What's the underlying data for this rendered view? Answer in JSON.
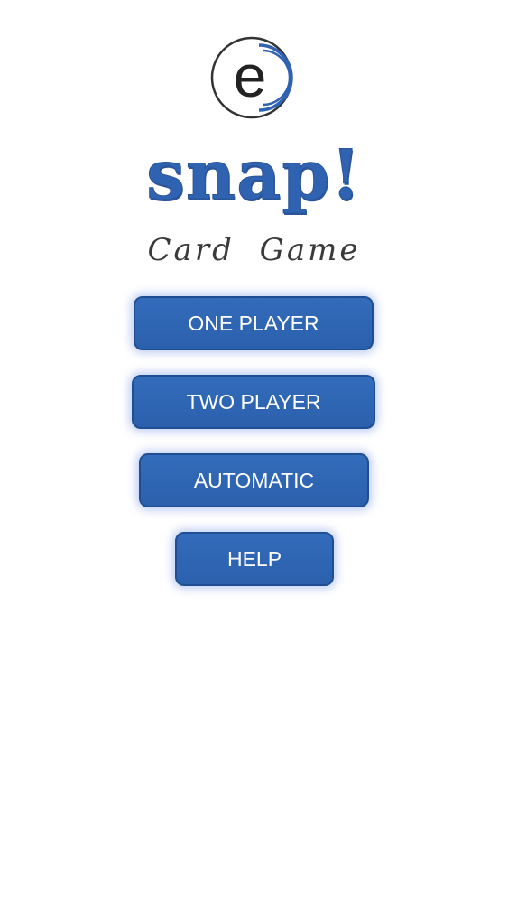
{
  "logo": {
    "icon": "e-circle-logo-icon",
    "letter": "e",
    "ring_color": "#2f62b0",
    "letter_color": "#222222"
  },
  "title": "snap!",
  "subtitle": "Card Game",
  "menu": {
    "one_player": "ONE PLAYER",
    "two_player": "TWO PLAYER",
    "automatic": "AUTOMATIC",
    "help": "HELP"
  },
  "colors": {
    "brand_blue": "#2f62b0",
    "button_blue": "#2f66b5",
    "button_text": "#ffffff"
  }
}
